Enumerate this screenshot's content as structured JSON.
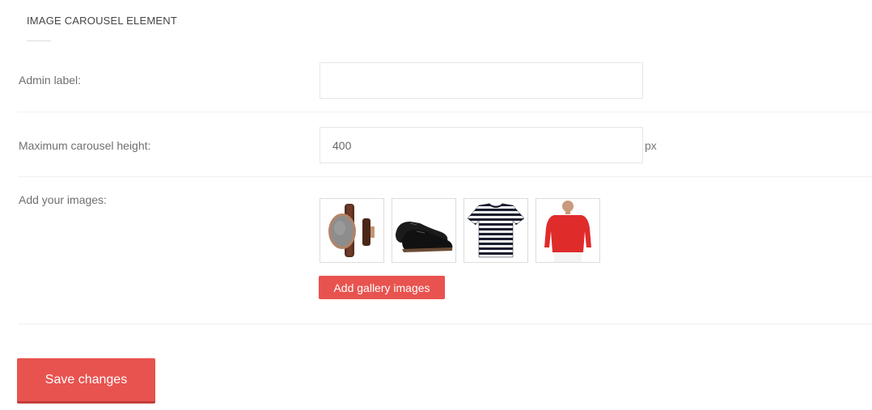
{
  "section": {
    "title": "IMAGE CAROUSEL ELEMENT"
  },
  "fields": {
    "admin_label": {
      "label": "Admin label:",
      "value": ""
    },
    "max_height": {
      "label": "Maximum carousel height:",
      "value": "400",
      "unit": "px"
    },
    "images": {
      "label": "Add your images:",
      "items": [
        {
          "icon": "watch-icon"
        },
        {
          "icon": "shoes-icon"
        },
        {
          "icon": "striped-tshirt-icon"
        },
        {
          "icon": "red-sweater-icon"
        }
      ],
      "add_button": "Add gallery images"
    }
  },
  "actions": {
    "save_label": "Save changes"
  },
  "colors": {
    "accent": "#e8534f",
    "accent_dark": "#c23d39",
    "border": "#e6e6e6"
  }
}
